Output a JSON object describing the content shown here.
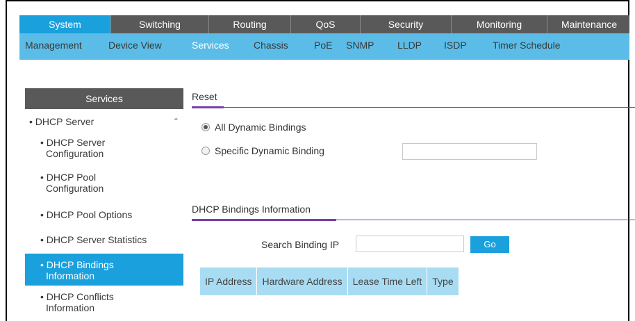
{
  "main_tabs": [
    {
      "label": "System",
      "active": true
    },
    {
      "label": "Switching",
      "active": false
    },
    {
      "label": "Routing",
      "active": false
    },
    {
      "label": "QoS",
      "active": false
    },
    {
      "label": "Security",
      "active": false
    },
    {
      "label": "Monitoring",
      "active": false
    },
    {
      "label": "Maintenance",
      "active": false
    }
  ],
  "sub_tabs": [
    {
      "label": "Management",
      "active": false
    },
    {
      "label": "Device View",
      "active": false
    },
    {
      "label": "Services",
      "active": true
    },
    {
      "label": "Chassis",
      "active": false
    },
    {
      "label": "PoE",
      "active": false
    },
    {
      "label": "SNMP",
      "active": false
    },
    {
      "label": "LLDP",
      "active": false
    },
    {
      "label": "ISDP",
      "active": false
    },
    {
      "label": "Timer Schedule",
      "active": false
    }
  ],
  "sidebar": {
    "header": "Services",
    "group": {
      "label": "• DHCP Server",
      "expand_icon": "chevron-up-icon"
    },
    "items": [
      {
        "line1": "• DHCP Server",
        "line2": "Configuration",
        "active": false
      },
      {
        "line1": "• DHCP Pool",
        "line2": "Configuration",
        "active": false
      },
      {
        "line1": "• DHCP Pool Options",
        "line2": "",
        "active": false
      },
      {
        "line1": "• DHCP Server Statistics",
        "line2": "",
        "active": false
      },
      {
        "line1": "• DHCP Bindings",
        "line2": "Information",
        "active": true
      },
      {
        "line1": "• DHCP Conflicts",
        "line2": "Information",
        "active": false
      }
    ]
  },
  "reset": {
    "title": "Reset",
    "options": [
      {
        "label": "All Dynamic Bindings",
        "selected": true
      },
      {
        "label": "Specific Dynamic Binding",
        "selected": false
      }
    ],
    "specific_value": ""
  },
  "bindings": {
    "title": "DHCP Bindings Information",
    "search_label": "Search Binding IP",
    "search_value": "",
    "go_label": "Go",
    "columns": [
      "IP Address",
      "Hardware Address",
      "Lease Time Left",
      "Type"
    ]
  },
  "colors": {
    "accent": "#1aa0dd",
    "tab_bg": "#595959",
    "subtab_bg": "#5bbde7",
    "section_line": "#7a3ea8",
    "table_head": "#a8dcf3"
  }
}
